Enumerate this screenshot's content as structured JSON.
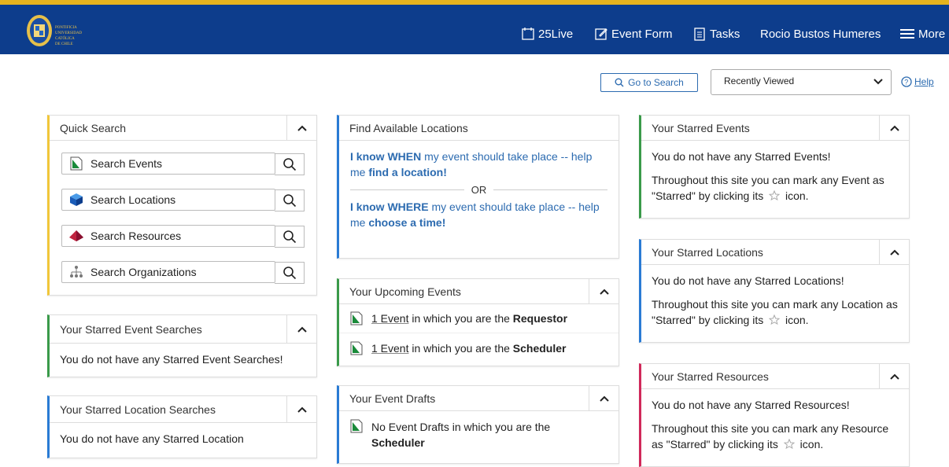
{
  "header": {
    "logo_text": "PONTIFICIA UNIVERSIDAD CATÓLICA DE CHILE",
    "nav": {
      "live": "25Live",
      "event_form": "Event Form",
      "tasks": "Tasks",
      "user": "Rocio Bustos Humeres",
      "more": "More"
    }
  },
  "toolbar": {
    "go_to_search": "Go to Search",
    "recent_select": "Recently Viewed",
    "help": "Help"
  },
  "quick_search": {
    "title": "Quick Search",
    "buttons": [
      "Search Events",
      "Search Locations",
      "Search Resources",
      "Search Organizations"
    ]
  },
  "starred_event_searches": {
    "title": "Your Starred Event Searches",
    "message": "You do not have any Starred Event Searches!"
  },
  "starred_location_searches": {
    "title": "Your Starred Location Searches",
    "message": "You do not have any Starred Location"
  },
  "find_locations": {
    "title": "Find Available Locations",
    "when": {
      "a": "I know WHEN",
      "b": " my event should take place -- help me ",
      "c": "find a location!"
    },
    "or": "OR",
    "where": {
      "a": "I know WHERE",
      "b": " my event should take place -- help me ",
      "c": "choose a time!"
    }
  },
  "upcoming": {
    "title": "Your Upcoming Events",
    "rows": [
      {
        "link": "1 Event",
        "text": " in which you are the ",
        "role": "Requestor"
      },
      {
        "link": "1 Event",
        "text": " in which you are the ",
        "role": "Scheduler"
      }
    ]
  },
  "drafts": {
    "title": "Your Event Drafts",
    "text": "No Event Drafts in which you are the",
    "role": "Scheduler"
  },
  "starred_events": {
    "title": "Your Starred Events",
    "message": "You do not have any Starred Events!",
    "hint_a": "Throughout this site you can mark any Event as \"Starred\" by clicking its",
    "hint_b": "icon."
  },
  "starred_locations": {
    "title": "Your Starred Locations",
    "message": "You do not have any Starred Locations!",
    "hint_a": "Throughout this site you can mark any Location as \"Starred\" by clicking its",
    "hint_b": "icon."
  },
  "starred_resources": {
    "title": "Your Starred Resources",
    "message": "You do not have any Starred Resources!",
    "hint_a": "Throughout this site you can mark any Resource as \"Starred\" by clicking its",
    "hint_b": "icon."
  }
}
